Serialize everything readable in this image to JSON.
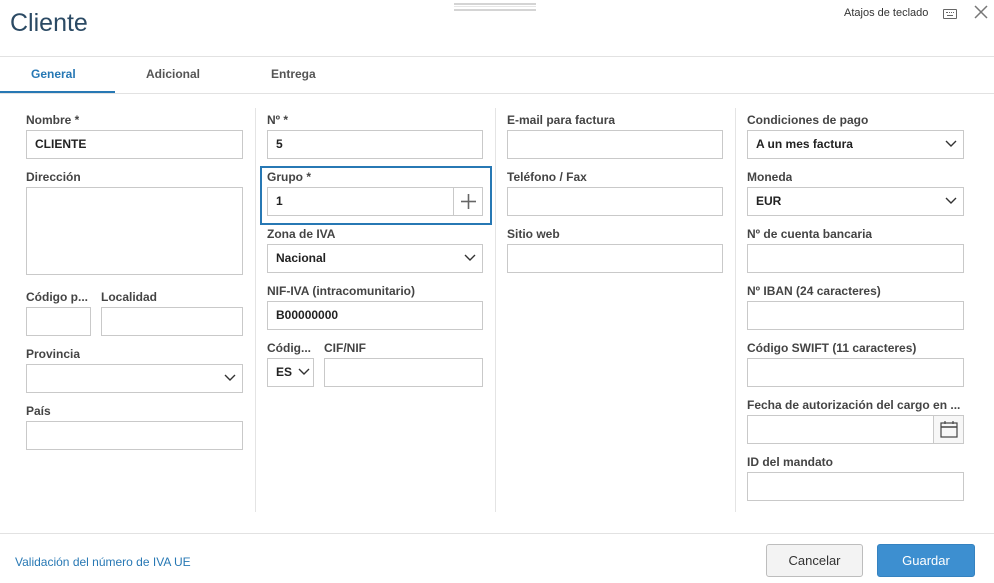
{
  "dialog": {
    "title": "Cliente",
    "shortcuts_label": "Atajos de teclado"
  },
  "tabs": [
    {
      "label": "General",
      "active": true
    },
    {
      "label": "Adicional",
      "active": false
    },
    {
      "label": "Entrega",
      "active": false
    }
  ],
  "fields": {
    "nombre": {
      "label": "Nombre *",
      "value": "CLIENTE"
    },
    "direccion": {
      "label": "Dirección",
      "value": ""
    },
    "codigo_postal": {
      "label": "Código p...",
      "value": ""
    },
    "localidad": {
      "label": "Localidad",
      "value": ""
    },
    "provincia": {
      "label": "Provincia",
      "value": ""
    },
    "pais": {
      "label": "País",
      "value": ""
    },
    "numero": {
      "label": "Nº *",
      "value": "5"
    },
    "grupo": {
      "label": "Grupo *",
      "value": "1"
    },
    "zona_iva": {
      "label": "Zona de IVA",
      "value": "Nacional"
    },
    "nif_iva": {
      "label": "NIF-IVA (intracomunitario)",
      "value": "B00000000"
    },
    "codigo_pais": {
      "label": "Códig...",
      "value": "ES"
    },
    "cif_nif": {
      "label": "CIF/NIF",
      "value": ""
    },
    "email_factura": {
      "label": "E-mail para factura",
      "value": ""
    },
    "telefono_fax": {
      "label": "Teléfono / Fax",
      "value": ""
    },
    "sitio_web": {
      "label": "Sitio web",
      "value": ""
    },
    "condiciones_pago": {
      "label": "Condiciones de pago",
      "value": "A un mes factura"
    },
    "moneda": {
      "label": "Moneda",
      "value": "EUR"
    },
    "cuenta_bancaria": {
      "label": "Nº de cuenta bancaria",
      "value": ""
    },
    "iban": {
      "label": "Nº IBAN (24 caracteres)",
      "value": ""
    },
    "swift": {
      "label": "Código SWIFT (11 caracteres)",
      "value": ""
    },
    "fecha_autorizacion": {
      "label": "Fecha de autorización del cargo en ...",
      "value": ""
    },
    "id_mandato": {
      "label": "ID del mandato",
      "value": ""
    }
  },
  "footer": {
    "vat_link": "Validación del número de IVA UE",
    "cancel_label": "Cancelar",
    "save_label": "Guardar"
  },
  "colors": {
    "accent": "#2778b4",
    "primary_button": "#3d8fd0",
    "title": "#2b4a64"
  },
  "icons": [
    "keyboard-icon",
    "close-icon",
    "plus-icon",
    "chevron-down-icon",
    "calendar-icon"
  ]
}
